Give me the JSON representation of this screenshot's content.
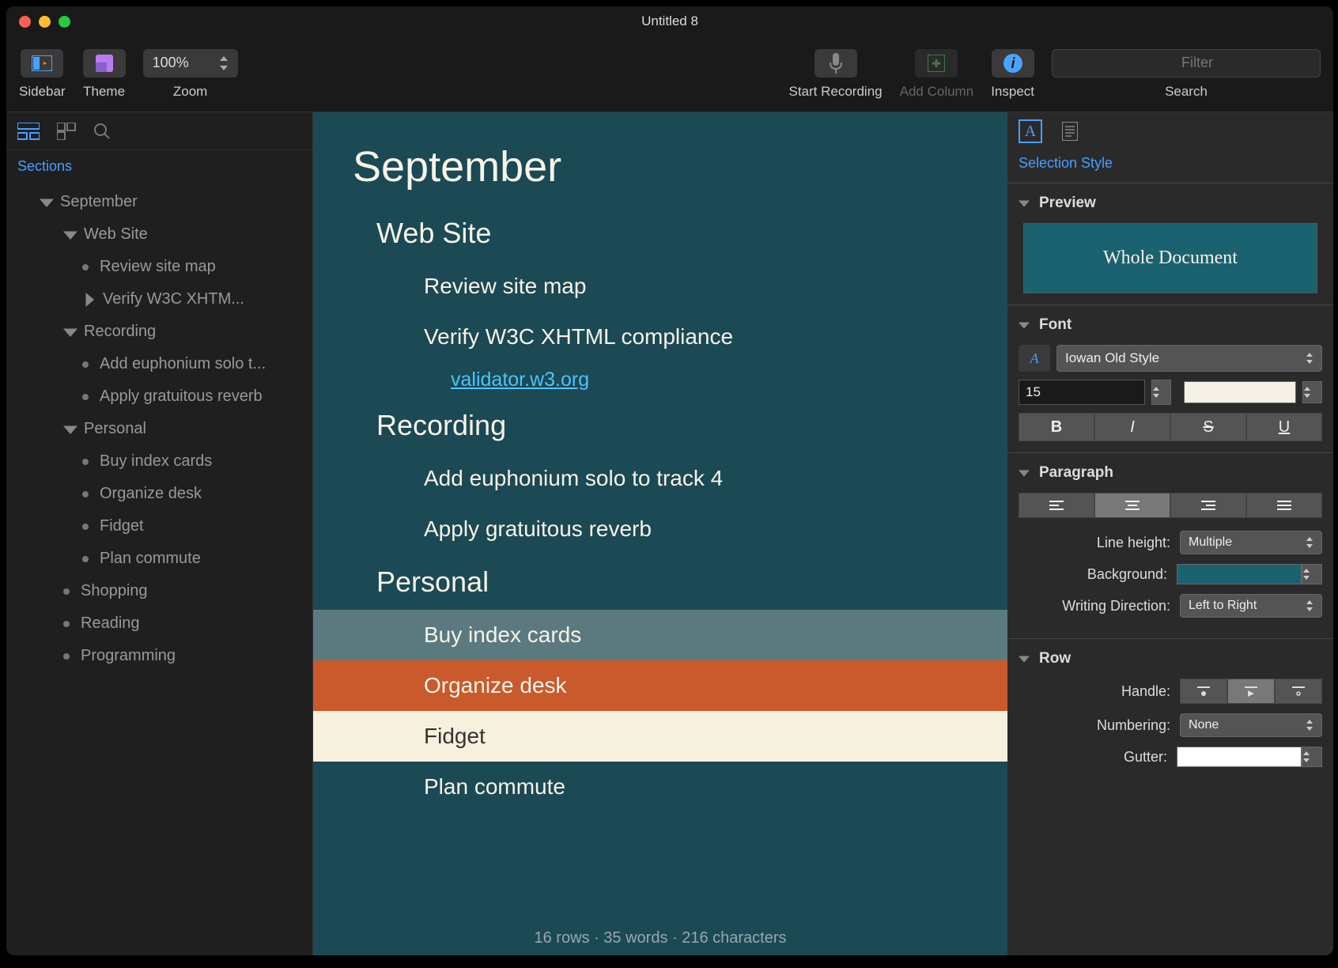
{
  "window": {
    "title": "Untitled 8"
  },
  "toolbar": {
    "sidebar_label": "Sidebar",
    "theme_label": "Theme",
    "zoom_label": "Zoom",
    "zoom_value": "100%",
    "start_recording_label": "Start Recording",
    "add_column_label": "Add Column",
    "inspect_label": "Inspect",
    "search_label": "Search",
    "filter_placeholder": "Filter"
  },
  "sidebar": {
    "section_label": "Sections",
    "tree": {
      "root": "September",
      "sections": [
        {
          "name": "Web Site",
          "items": [
            "Review site map",
            "Verify W3C XHTM..."
          ]
        },
        {
          "name": "Recording",
          "items": [
            "Add euphonium solo t...",
            "Apply gratuitous reverb"
          ]
        },
        {
          "name": "Personal",
          "items": [
            "Buy index cards",
            "Organize desk",
            "Fidget",
            "Plan commute"
          ]
        }
      ],
      "top_items": [
        "Shopping",
        "Reading",
        "Programming"
      ]
    }
  },
  "doc": {
    "h1": "September",
    "sections": [
      {
        "title": "Web Site",
        "items": [
          {
            "text": "Review site map"
          },
          {
            "text": "Verify W3C XHTML compliance",
            "link": "validator.w3.org"
          }
        ]
      },
      {
        "title": "Recording",
        "items": [
          {
            "text": "Add euphonium solo to track 4"
          },
          {
            "text": "Apply gratuitous reverb"
          }
        ]
      },
      {
        "title": "Personal",
        "items": [
          {
            "text": "Buy index cards",
            "style": "teal"
          },
          {
            "text": "Organize desk",
            "style": "orange"
          },
          {
            "text": "Fidget",
            "style": "cream"
          },
          {
            "text": "Plan commute"
          }
        ]
      }
    ],
    "status": "16 rows · 35 words · 216 characters"
  },
  "inspector": {
    "title": "Selection Style",
    "preview_label": "Preview",
    "preview_text": "Whole Document",
    "font_label": "Font",
    "font_name": "Iowan Old Style",
    "font_size": "15",
    "bold": "B",
    "italic": "I",
    "strike": "S",
    "underline": "U",
    "paragraph_label": "Paragraph",
    "line_height_label": "Line height:",
    "line_height_value": "Multiple",
    "background_label": "Background:",
    "writing_dir_label": "Writing Direction:",
    "writing_dir_value": "Left to Right",
    "row_label": "Row",
    "handle_label": "Handle:",
    "numbering_label": "Numbering:",
    "numbering_value": "None",
    "gutter_label": "Gutter:"
  }
}
